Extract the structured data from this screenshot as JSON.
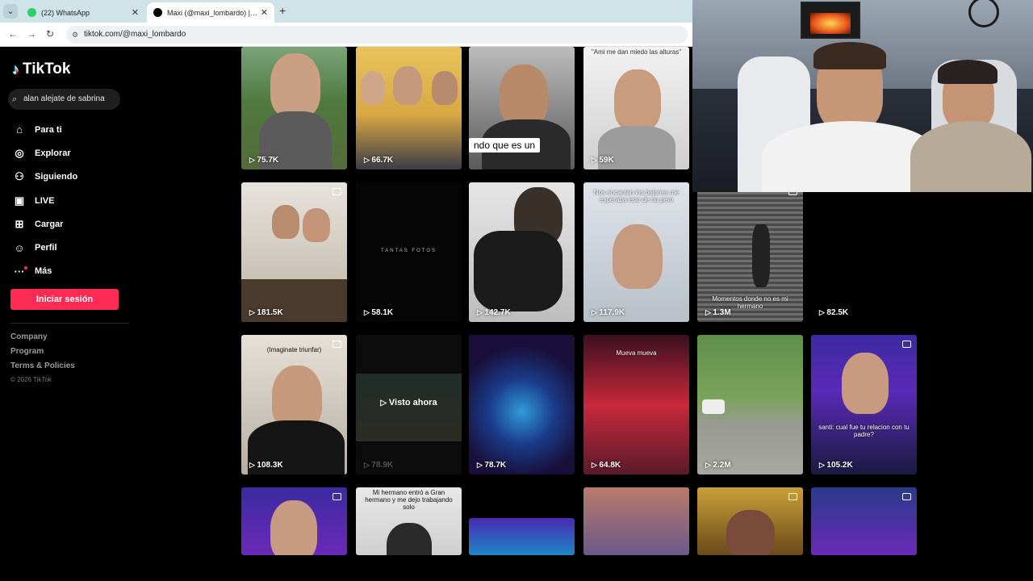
{
  "browser": {
    "tabs": [
      {
        "title": "(22) WhatsApp",
        "color": "#25d366"
      },
      {
        "title": "Maxi (@maxi_lombardo) | TikTok",
        "color": "#000000"
      }
    ],
    "url": "tiktok.com/@maxi_lombardo"
  },
  "sidebar": {
    "logo": "TikTok",
    "search_value": "alan alejate de sabrina",
    "nav": [
      {
        "label": "Para ti",
        "icon": "home-icon"
      },
      {
        "label": "Explorar",
        "icon": "compass-icon"
      },
      {
        "label": "Siguiendo",
        "icon": "following-icon"
      },
      {
        "label": "LIVE",
        "icon": "live-icon"
      },
      {
        "label": "Cargar",
        "icon": "upload-icon"
      },
      {
        "label": "Perfil",
        "icon": "profile-icon"
      },
      {
        "label": "Más",
        "icon": "more-icon"
      }
    ],
    "login_label": "Iniciar sesión",
    "footer": [
      "Company",
      "Program",
      "Terms & Policies"
    ],
    "copyright": "© 2026 TikTok"
  },
  "videos": {
    "row1": [
      "75.7K",
      "66.7K",
      "",
      "59K"
    ],
    "row1_caption_4": "\"Ami me dan miedo las alturas\"",
    "row1_overlay_3": "ndo que es un",
    "row2": [
      "181.5K",
      "58.1K",
      "142.7K",
      "117.9K",
      "1.3M",
      "82.5K"
    ],
    "row2_caption_2": "TANTAS FOTOS",
    "row2_caption_4": "Nos encantan los bajones me esperaba esto de no pero",
    "row2_caption_5": "Momentos donde no es mi hermano",
    "row3": [
      "108.3K",
      "78.9K",
      "78.7K",
      "64.8K",
      "2.2M",
      "105.2K"
    ],
    "row3_caption_1": "(Imaginate triunfar)",
    "row3_watched": "Visto ahora",
    "row3_caption_4": "Mueva mueva",
    "row3_caption_6": "santi: cual fue tu relacion con tu padre?",
    "row4_caption_2": "Mi hermano entró a Gran hermano y me dejo trabajando solo"
  }
}
